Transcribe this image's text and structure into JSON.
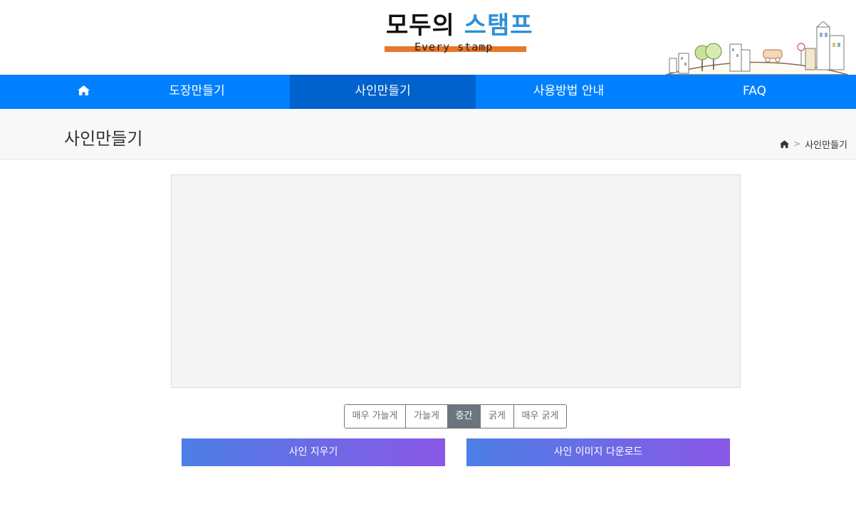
{
  "header": {
    "logo": {
      "korean_part1": "모두의",
      "korean_part2": "스탬프",
      "english": "Every stamp"
    }
  },
  "nav": {
    "home_icon": "home-icon",
    "items": [
      {
        "label": "도장만들기"
      },
      {
        "label": "사인만들기",
        "active": true
      },
      {
        "label": "사용방법 안내"
      },
      {
        "label": "FAQ"
      }
    ]
  },
  "page": {
    "title": "사인만들기",
    "breadcrumb": {
      "home_icon": "home-icon",
      "separator": ">",
      "current": "사인만들기"
    }
  },
  "thickness": {
    "options": [
      "매우 가늘게",
      "가늘게",
      "중간",
      "굵게",
      "매우 굵게"
    ],
    "selected": "중간"
  },
  "actions": {
    "clear_label": "사인 지우기",
    "download_label": "사인 이미지 다운로드"
  },
  "colors": {
    "nav_bg": "#0080ff",
    "nav_active_bg": "#0062cc",
    "button_gradient_start": "#4c7fe6",
    "button_gradient_end": "#8a57e6",
    "canvas_bg": "#f4f4f4",
    "logo_accent_bar": "#e8772a"
  }
}
